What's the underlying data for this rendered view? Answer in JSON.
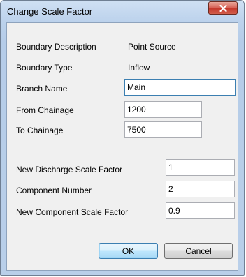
{
  "window": {
    "title": "Change Scale Factor"
  },
  "fields": {
    "boundary_description": {
      "label": "Boundary Description",
      "value": "Point Source"
    },
    "boundary_type": {
      "label": "Boundary Type",
      "value": "Inflow"
    },
    "branch_name": {
      "label": "Branch Name",
      "value": "Main"
    },
    "from_chainage": {
      "label": "From Chainage",
      "value": "1200"
    },
    "to_chainage": {
      "label": "To Chainage",
      "value": "7500"
    },
    "new_discharge_scale_factor": {
      "label": "New Discharge Scale Factor",
      "value": "1"
    },
    "component_number": {
      "label": "Component Number",
      "value": "2"
    },
    "new_component_scale_factor": {
      "label": "New Component Scale Factor",
      "value": "0.9"
    }
  },
  "buttons": {
    "ok": "OK",
    "cancel": "Cancel"
  },
  "icons": {
    "close": "close-icon"
  }
}
